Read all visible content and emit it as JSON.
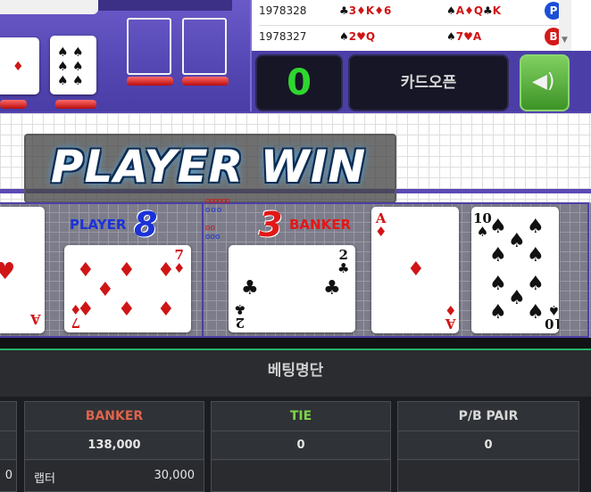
{
  "history": [
    {
      "round": "1978328",
      "player_cards": [
        [
          "♣",
          "3"
        ],
        [
          "♦",
          "K"
        ],
        [
          "♦",
          "6"
        ]
      ],
      "banker_cards": [
        [
          "♠",
          "A"
        ],
        [
          "♦",
          "Q"
        ],
        [
          "♣",
          "K"
        ]
      ],
      "result": "P",
      "result_color": "#1b4fd6"
    },
    {
      "round": "1978327",
      "player_cards": [
        [
          "♠",
          "2"
        ],
        [
          "♥",
          "Q"
        ]
      ],
      "banker_cards": [
        [
          "♠",
          "7"
        ],
        [
          "♥",
          "A"
        ]
      ],
      "result": "B",
      "result_color": "#d41919"
    }
  ],
  "controls": {
    "counter": "0",
    "card_open_label": "카드오픈",
    "sound_icon": "speaker-icon"
  },
  "banner": {
    "text": "PLAYER WIN"
  },
  "player": {
    "label": "PLAYER",
    "score": "8",
    "card_rank": "7",
    "card_suit": "♦",
    "partial_card_rank": "A",
    "partial_card_suit": "♥"
  },
  "banker": {
    "label": "BANKER",
    "score": "3",
    "cards": [
      {
        "rank": "2",
        "suit": "♣"
      },
      {
        "rank": "A",
        "suit": "♦"
      },
      {
        "rank": "10",
        "suit": "♠"
      }
    ]
  },
  "table_cards": [
    {
      "rank": "A",
      "suit": "♦"
    },
    {
      "rank": "10",
      "suit": "♠"
    }
  ],
  "betting": {
    "title": "베팅명단",
    "left_partial": {
      "value_tail": "0"
    },
    "columns": [
      {
        "header": "BANKER",
        "header_color": "#e0634d",
        "total": "138,000",
        "row_name": "랩터",
        "row_value": "30,000"
      },
      {
        "header": "TIE",
        "header_color": "#7fd34a",
        "total": "0"
      },
      {
        "header": "P/B PAIR",
        "header_color": "#d8d8d8",
        "total": "0"
      }
    ]
  },
  "colors": {
    "accent_purple": "#5447b3",
    "player_blue": "#1b32d8",
    "banker_red": "#e21717",
    "green_line": "#2ab56b"
  }
}
